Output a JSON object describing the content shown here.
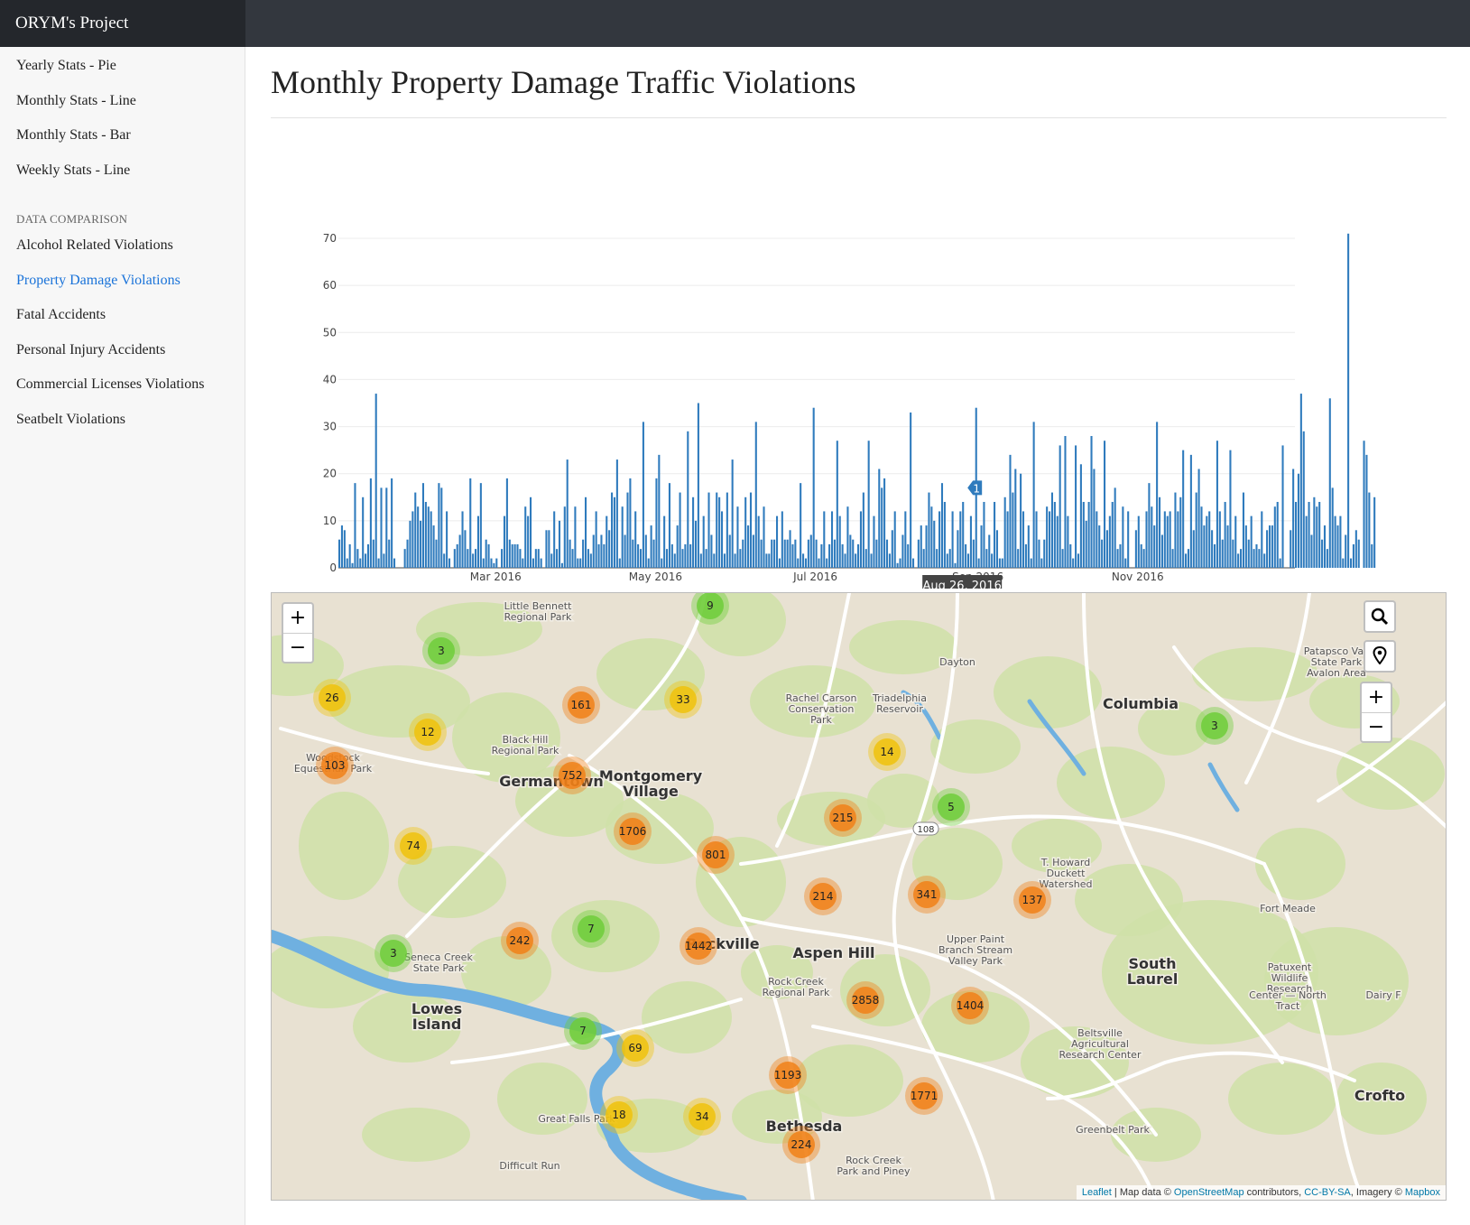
{
  "app": {
    "brand": "ORYM's Project"
  },
  "sidebar": {
    "items_top": [
      {
        "label": "Yearly Stats - Pie"
      },
      {
        "label": "Monthly Stats - Line"
      },
      {
        "label": "Monthly Stats - Bar"
      },
      {
        "label": "Weekly Stats - Line"
      }
    ],
    "section_heading": "DATA COMPARISON",
    "items_compare": [
      {
        "label": "Alcohol Related Violations",
        "active": false
      },
      {
        "label": "Property Damage Violations",
        "active": true
      },
      {
        "label": "Fatal Accidents",
        "active": false
      },
      {
        "label": "Personal Injury Accidents",
        "active": false
      },
      {
        "label": "Commercial Licenses Violations",
        "active": false
      },
      {
        "label": "Seatbelt Violations",
        "active": false
      }
    ]
  },
  "page": {
    "title": "Monthly Property Damage Traffic Violations"
  },
  "chart_data": {
    "type": "bar",
    "x_start": "2016-01-01",
    "x_end": "2016-12-31",
    "x_ticks": [
      "Mar 2016",
      "May 2016",
      "Jul 2016",
      "Sep 2016",
      "Nov 2016"
    ],
    "y_ticks": [
      0,
      10,
      20,
      30,
      40,
      50,
      60,
      70
    ],
    "ylim": [
      0,
      70
    ],
    "bar_color": "#2f7bbd",
    "values": [
      6,
      9,
      8,
      2,
      5,
      1,
      18,
      4,
      2,
      15,
      3,
      5,
      19,
      6,
      37,
      2,
      17,
      3,
      17,
      6,
      19,
      2,
      0,
      0,
      0,
      4,
      6,
      10,
      12,
      16,
      13,
      10,
      18,
      14,
      13,
      12,
      9,
      6,
      18,
      17,
      3,
      12,
      2,
      0,
      4,
      5,
      7,
      12,
      8,
      4,
      19,
      3,
      4,
      11,
      18,
      2,
      6,
      5,
      2,
      1,
      2,
      0,
      4,
      11,
      19,
      6,
      5,
      5,
      5,
      4,
      2,
      13,
      11,
      15,
      2,
      4,
      4,
      2,
      0,
      8,
      8,
      3,
      12,
      4,
      10,
      1,
      13,
      23,
      6,
      4,
      13,
      2,
      2,
      6,
      15,
      4,
      3,
      7,
      12,
      5,
      7,
      5,
      11,
      8,
      16,
      15,
      23,
      2,
      13,
      7,
      16,
      19,
      6,
      12,
      5,
      4,
      31,
      7,
      2,
      9,
      6,
      19,
      24,
      2,
      11,
      4,
      18,
      5,
      3,
      9,
      16,
      4,
      5,
      29,
      5,
      15,
      10,
      35,
      3,
      11,
      4,
      16,
      7,
      3,
      16,
      15,
      12,
      3,
      16,
      7,
      23,
      3,
      13,
      4,
      6,
      15,
      9,
      16,
      7,
      31,
      11,
      6,
      13,
      3,
      3,
      6,
      6,
      11,
      2,
      12,
      6,
      6,
      8,
      5,
      6,
      2,
      18,
      3,
      2,
      6,
      7,
      34,
      6,
      2,
      5,
      12,
      2,
      5,
      12,
      6,
      27,
      11,
      5,
      3,
      13,
      7,
      6,
      3,
      5,
      12,
      16,
      4,
      27,
      3,
      11,
      6,
      21,
      17,
      19,
      6,
      3,
      8,
      12,
      1,
      2,
      7,
      12,
      5,
      33,
      2,
      0,
      6,
      9,
      4,
      9,
      16,
      13,
      10,
      4,
      12,
      18,
      14,
      3,
      4,
      12,
      1,
      8,
      12,
      14,
      5,
      3,
      11,
      6,
      34,
      2,
      9,
      14,
      4,
      7,
      3,
      14,
      8,
      2,
      2,
      15,
      12,
      24,
      16,
      21,
      4,
      20,
      12,
      5,
      9,
      2,
      31,
      12,
      6,
      2,
      6,
      13,
      12,
      16,
      14,
      11,
      26,
      4,
      28,
      11,
      5,
      2,
      26,
      3,
      22,
      14,
      10,
      14,
      28,
      21,
      12,
      9,
      6,
      27,
      8,
      11,
      14,
      17,
      4,
      5,
      13,
      2,
      12,
      0,
      0,
      8,
      11,
      5,
      4,
      12,
      18,
      13,
      9,
      31,
      15,
      7,
      12,
      11,
      12,
      4,
      16,
      12,
      15,
      25,
      3,
      4,
      24,
      8,
      16,
      21,
      13,
      9,
      11,
      12,
      8,
      5,
      27,
      12,
      6,
      14,
      9,
      25,
      6,
      11,
      3,
      4,
      16,
      9,
      6,
      11,
      4,
      5,
      4,
      12,
      3,
      8,
      9,
      9,
      13,
      14,
      2,
      26,
      0,
      0,
      8,
      21,
      14,
      20,
      37,
      29,
      11,
      14,
      7,
      15,
      13,
      14,
      6,
      9,
      4,
      36,
      17,
      11,
      9,
      11,
      2,
      7,
      71,
      2,
      5,
      8,
      6,
      0,
      27,
      24,
      16,
      5,
      15,
      0
    ]
  },
  "chart_tooltip": {
    "label": "Aug 26, 2016",
    "date": "2016-08-26",
    "badge": "1"
  },
  "map": {
    "places": [
      {
        "name": "Little Bennett",
        "sub": "Regional Park"
      },
      {
        "name": "Dayton"
      },
      {
        "name": "Columbia"
      },
      {
        "name": "Rachel Carson",
        "sub": "Conservation",
        "sub2": "Park"
      },
      {
        "name": "Triadelphia",
        "sub": "Reservoir"
      },
      {
        "name": "Black Hill",
        "sub": "Regional Park"
      },
      {
        "name": "Montgomery",
        "sub": "Village"
      },
      {
        "name": "Germantown"
      },
      {
        "name": "Patapsco Vall",
        "sub": "State Park",
        "sub2": "Avalon Area"
      },
      {
        "name": "Woodstock",
        "sub": "Equestrian Park"
      },
      {
        "name": "T. Howard",
        "sub": "Duckett",
        "sub2": "Watershed"
      },
      {
        "name": "Fort Meade"
      },
      {
        "name": "Rockville"
      },
      {
        "name": "Aspen Hill"
      },
      {
        "name": "Upper Paint",
        "sub": "Branch Stream",
        "sub2": "Valley Park"
      },
      {
        "name": "South",
        "sub": "Laurel"
      },
      {
        "name": "Patuxent",
        "sub": "Wildlife",
        "sub2": "Research"
      },
      {
        "name": "Seneca Creek",
        "sub": "State Park"
      },
      {
        "name": "Rock Creek",
        "sub": "Regional Park"
      },
      {
        "name": "Lowes",
        "sub": "Island"
      },
      {
        "name": "Beltsville",
        "sub": "Agricultural",
        "sub2": "Research Center"
      },
      {
        "name": "Crofto"
      },
      {
        "name": "Great Falls Park"
      },
      {
        "name": "Bethesda"
      },
      {
        "name": "Greenbelt Park"
      },
      {
        "name": "Difficult Run"
      },
      {
        "name": "Rock Creek",
        "sub": "Park and Piney"
      },
      {
        "name": "Dairy F"
      },
      {
        "name": "Center — North",
        "sub": "Tract"
      }
    ],
    "road_shield": "108",
    "clusters": [
      {
        "n": "9",
        "c": "green"
      },
      {
        "n": "3",
        "c": "green"
      },
      {
        "n": "26",
        "c": "yellow"
      },
      {
        "n": "12",
        "c": "yellow"
      },
      {
        "n": "161",
        "c": "orange"
      },
      {
        "n": "33",
        "c": "yellow"
      },
      {
        "n": "103",
        "c": "orange"
      },
      {
        "n": "752",
        "c": "orange"
      },
      {
        "n": "14",
        "c": "yellow"
      },
      {
        "n": "3",
        "c": "green"
      },
      {
        "n": "5",
        "c": "green"
      },
      {
        "n": "215",
        "c": "orange"
      },
      {
        "n": "1706",
        "c": "orange"
      },
      {
        "n": "74",
        "c": "yellow"
      },
      {
        "n": "801",
        "c": "orange"
      },
      {
        "n": "214",
        "c": "orange"
      },
      {
        "n": "341",
        "c": "orange"
      },
      {
        "n": "137",
        "c": "orange"
      },
      {
        "n": "7",
        "c": "green"
      },
      {
        "n": "242",
        "c": "orange"
      },
      {
        "n": "3",
        "c": "green"
      },
      {
        "n": "1442",
        "c": "orange"
      },
      {
        "n": "2858",
        "c": "orange"
      },
      {
        "n": "1404",
        "c": "orange"
      },
      {
        "n": "7",
        "c": "green"
      },
      {
        "n": "69",
        "c": "yellow"
      },
      {
        "n": "1193",
        "c": "orange"
      },
      {
        "n": "1771",
        "c": "orange"
      },
      {
        "n": "18",
        "c": "yellow"
      },
      {
        "n": "34",
        "c": "yellow"
      },
      {
        "n": "224",
        "c": "orange"
      }
    ],
    "cluster_colors": {
      "green": "#6ecc39",
      "yellow": "#f0c20c",
      "orange": "#f18017"
    },
    "zoom_in": "+",
    "zoom_out": "−",
    "attribution": {
      "leaflet": "Leaflet",
      "sep1": " | Map data © ",
      "osm": "OpenStreetMap",
      "sep2": " contributors, ",
      "license": "CC-BY-SA",
      "sep3": ", Imagery © ",
      "mapbox": "Mapbox"
    }
  }
}
